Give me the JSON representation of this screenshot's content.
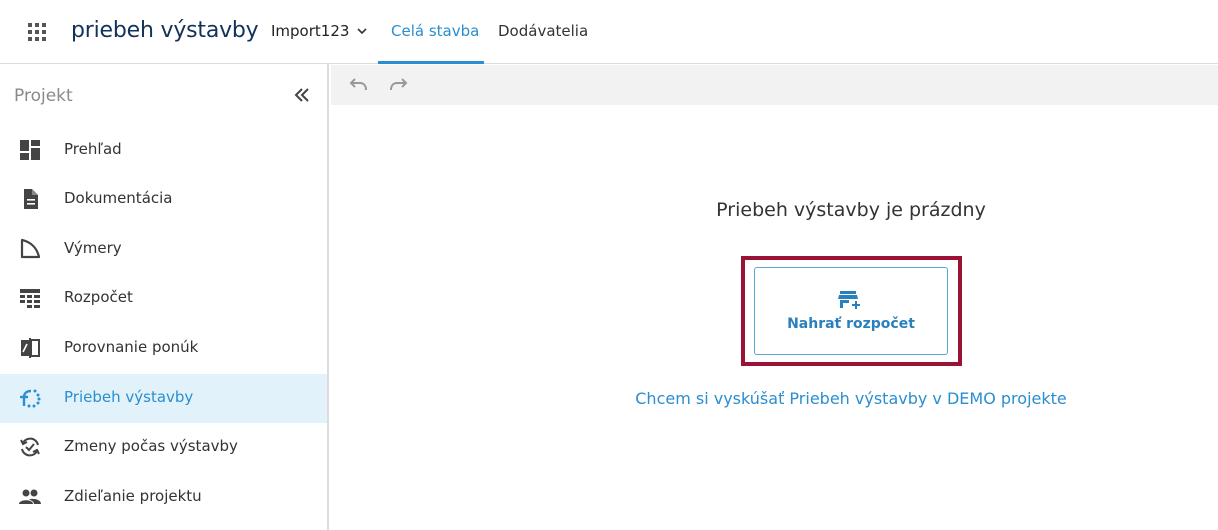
{
  "header": {
    "app_title": "priebeh výstavby",
    "project_select": {
      "value": "Import123"
    },
    "tabs": [
      {
        "label": "Celá stavba",
        "active": true
      },
      {
        "label": "Dodávatelia",
        "active": false
      }
    ]
  },
  "sidebar": {
    "title": "Projekt",
    "items": [
      {
        "label": "Prehľad",
        "icon": "dashboard-icon"
      },
      {
        "label": "Dokumentácia",
        "icon": "document-icon"
      },
      {
        "label": "Výmery",
        "icon": "measure-icon"
      },
      {
        "label": "Rozpočet",
        "icon": "budget-table-icon"
      },
      {
        "label": "Porovnanie ponúk",
        "icon": "compare-icon"
      },
      {
        "label": "Priebeh výstavby",
        "icon": "progress-icon",
        "active": true
      },
      {
        "label": "Zmeny počas výstavby",
        "icon": "changes-icon"
      },
      {
        "label": "Zdieľanie projektu",
        "icon": "people-icon"
      }
    ]
  },
  "main": {
    "empty_title": "Priebeh výstavby je prázdny",
    "upload_button_label": "Nahrať rozpočet",
    "demo_link": "Chcem si vyskúšať Priebeh výstavby v DEMO projekte"
  },
  "colors": {
    "accent": "#2a8ed0",
    "title_navy": "#12325a",
    "active_row_bg": "#e1f2fb",
    "highlight_border": "#9c1236"
  }
}
